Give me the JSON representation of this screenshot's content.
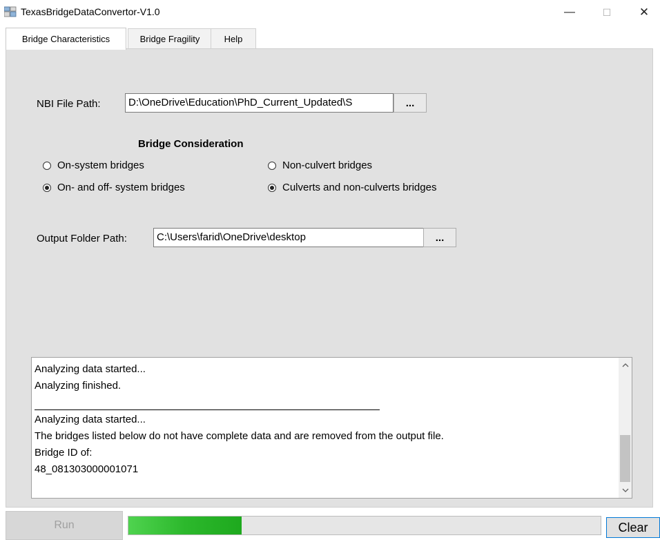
{
  "window": {
    "title": "TexasBridgeDataConvertor-V1.0",
    "minimize_glyph": "—",
    "maximize_glyph": "☐",
    "close_glyph": "✕"
  },
  "tabs": [
    {
      "label": "Bridge Characteristics",
      "active": true
    },
    {
      "label": "Bridge Fragility",
      "active": false
    },
    {
      "label": "Help",
      "active": false
    }
  ],
  "nbi": {
    "label": "NBI File Path:",
    "value": "D:\\OneDrive\\Education\\PhD_Current_Updated\\S",
    "browse_label": "..."
  },
  "consideration": {
    "heading": "Bridge Consideration",
    "options": [
      {
        "label": "On-system bridges",
        "checked": false
      },
      {
        "label": "On- and off- system bridges",
        "checked": true
      },
      {
        "label": "Non-culvert bridges",
        "checked": false
      },
      {
        "label": "Culverts and non-culverts bridges",
        "checked": true
      }
    ]
  },
  "output": {
    "label": "Output Folder Path:",
    "value": "C:\\Users\\farid\\OneDrive\\desktop",
    "browse_label": "..."
  },
  "log": {
    "lines": [
      "Analyzing  data started...",
      "Analyzing  finished.",
      "Analyzing  data started...",
      "The bridges listed below do not have complete data and are removed from the output file.",
      "Bridge ID of:",
      "48_081303000001071"
    ],
    "scroll_up_icon": "chevron-up",
    "scroll_down_icon": "chevron-down"
  },
  "actions": {
    "run_label": "Run",
    "clear_label": "Clear",
    "progress_fraction": 0.24
  },
  "colors": {
    "panel": "#e1e1e1",
    "progress_fill": "#2cb82c",
    "clear_border": "#0078d7"
  }
}
